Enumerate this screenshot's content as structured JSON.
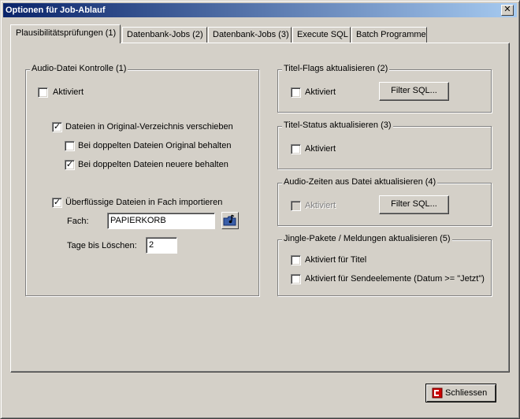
{
  "window": {
    "title": "Optionen für Job-Ablauf",
    "close_glyph": "✕"
  },
  "tabs": [
    {
      "label": "Plausibilitätsprüfungen (1)",
      "active": true
    },
    {
      "label": "Datenbank-Jobs (2)",
      "active": false
    },
    {
      "label": "Datenbank-Jobs (3)",
      "active": false
    },
    {
      "label": "Execute SQL",
      "active": false
    },
    {
      "label": "Batch Programme",
      "active": false
    }
  ],
  "audio_datei": {
    "title": "Audio-Datei Kontrolle (1)",
    "aktiviert": {
      "label": "Aktiviert",
      "checked": false
    },
    "verschieben": {
      "label": "Dateien in Original-Verzeichnis verschieben",
      "checked": true
    },
    "original_behalten": {
      "label": "Bei doppelten Dateien Original behalten",
      "checked": false
    },
    "neuere_behalten": {
      "label": "Bei doppelten Dateien neuere behalten",
      "checked": true
    },
    "importieren": {
      "label": "Überflüssige Dateien in Fach importieren",
      "checked": true
    },
    "fach_label": "Fach:",
    "fach_value": "PAPIERKORB",
    "tage_label": "Tage bis Löschen:",
    "tage_value": "2"
  },
  "titel_flags": {
    "title": "Titel-Flags aktualisieren (2)",
    "aktiviert": {
      "label": "Aktiviert",
      "checked": false
    },
    "filter_label": "Filter SQL..."
  },
  "titel_status": {
    "title": "Titel-Status aktualisieren (3)",
    "aktiviert": {
      "label": "Aktiviert",
      "checked": false
    }
  },
  "audio_zeiten": {
    "title": "Audio-Zeiten aus Datei aktualisieren (4)",
    "aktiviert": {
      "label": "Aktiviert",
      "checked": false,
      "disabled": true
    },
    "filter_label": "Filter SQL..."
  },
  "jingle": {
    "title": "Jingle-Pakete / Meldungen aktualisieren (5)",
    "titel": {
      "label": "Aktiviert für Titel",
      "checked": false
    },
    "sende": {
      "label": "Aktiviert für Sendeelemente (Datum >= \"Jetzt\")",
      "checked": false
    }
  },
  "footer": {
    "close_label": "Schliessen",
    "close_icon": "exit-icon",
    "close_icon_color": "#cc0000"
  },
  "check_glyph": "✓"
}
